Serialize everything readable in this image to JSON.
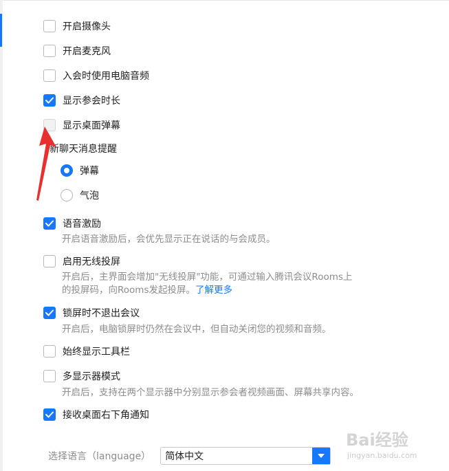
{
  "settings": [
    {
      "label": "开启摄像头",
      "state": "unchecked"
    },
    {
      "label": "开启麦克风",
      "state": "unchecked"
    },
    {
      "label": "入会时使用电脑音频",
      "state": "unchecked"
    },
    {
      "label": "显示参会时长",
      "state": "checked"
    },
    {
      "label": "显示桌面弹幕",
      "state": "disabled"
    }
  ],
  "chat_reminder": {
    "title": "新聊天消息提醒",
    "options": [
      {
        "label": "弹幕",
        "selected": true
      },
      {
        "label": "气泡",
        "selected": false
      }
    ]
  },
  "voice_incentive": {
    "label": "语音激励",
    "checked": true,
    "desc": "开启语音激励后，会优先显示正在说话的与会成员。"
  },
  "wireless_projection": {
    "label": "启用无线投屏",
    "checked": false,
    "desc_line1": "开启后，主界面会增加\"无线投屏\"功能，可通过输入腾讯会议Rooms上",
    "desc_line2": "的投屏码，向Rooms发起投屏。",
    "link": "了解更多"
  },
  "lock_screen": {
    "label": "锁屏时不退出会议",
    "checked": true,
    "desc": "开启后，电脑锁屏时仍然在会议中，但自动关闭您的视频和音频。"
  },
  "toolbar": {
    "label": "始终显示工具栏",
    "checked": false
  },
  "multi_display": {
    "label": "多显示器模式",
    "checked": false,
    "desc": "开启后，支持在两个显示器中分别显示参会者视频画面、屏幕共享内容。"
  },
  "desktop_notify": {
    "label": "接收桌面右下角通知",
    "checked": true
  },
  "language": {
    "label": "选择语言（language）",
    "value": "简体中文"
  },
  "watermark": {
    "brand": "Bai经验",
    "url": "jingyan.baidu.com"
  },
  "colors": {
    "accent": "#1677ff",
    "arrow": "#e8302f"
  },
  "icons": {
    "check": "check-icon",
    "dropdown": "chevron-down-icon",
    "pointer": "red-arrow-annotation"
  }
}
